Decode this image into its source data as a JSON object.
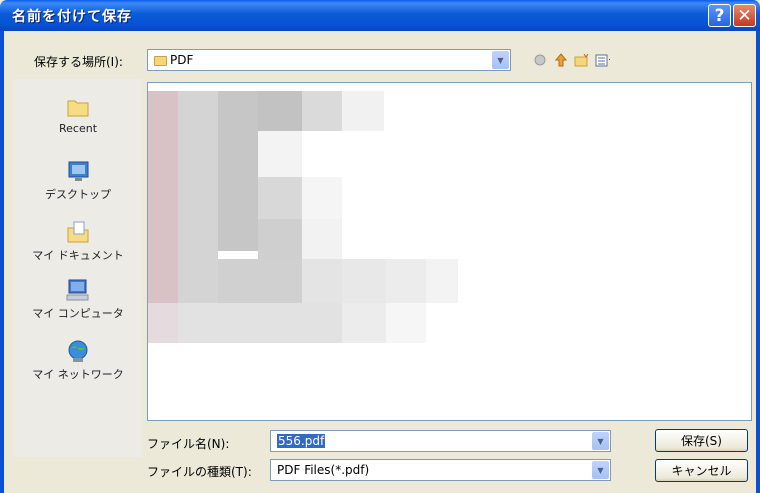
{
  "dialog": {
    "title": "名前を付けて保存",
    "help_glyph": "?",
    "close_glyph": "✕"
  },
  "lookin": {
    "label": "保存する場所(I):",
    "value": "PDF"
  },
  "toolbar_icons": [
    "back-icon",
    "up-folder-icon",
    "new-folder-icon",
    "view-menu-icon"
  ],
  "places": [
    {
      "label": "Recent",
      "icon": "recent-folder-icon"
    },
    {
      "label": "デスクトップ",
      "icon": "desktop-icon"
    },
    {
      "label": "マイ ドキュメント",
      "icon": "my-documents-icon"
    },
    {
      "label": "マイ コンピュータ",
      "icon": "my-computer-icon"
    },
    {
      "label": "マイ ネットワーク",
      "icon": "my-network-icon"
    }
  ],
  "filename": {
    "label": "ファイル名(N):",
    "value": "556.pdf"
  },
  "filetype": {
    "label": "ファイルの種類(T):",
    "value": "PDF Files(*.pdf)"
  },
  "buttons": {
    "save": "保存(S)",
    "cancel": "キャンセル"
  },
  "colors": {
    "titlebar": "#0553d4",
    "dialog_bg": "#ece9d8",
    "selection": "#316ac5"
  }
}
